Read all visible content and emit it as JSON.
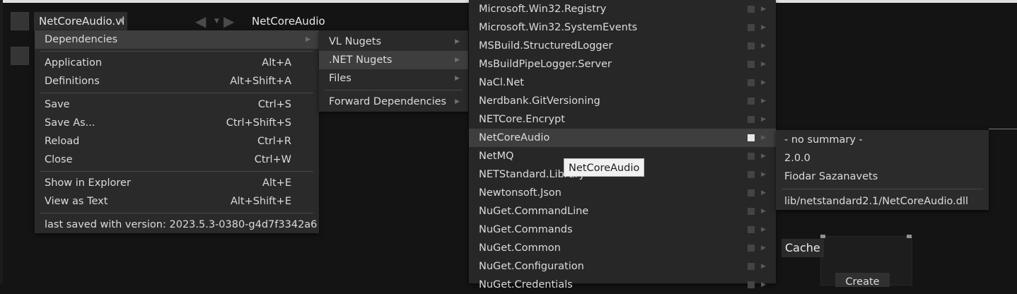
{
  "document": {
    "tab_label": "NetCoreAudio.vl",
    "title": "NetCoreAudio"
  },
  "main_menu": {
    "items": [
      {
        "label": "Dependencies",
        "shortcut": "",
        "submenu": true,
        "highlighted": true
      },
      {
        "label": "Application",
        "shortcut": "Alt+A"
      },
      {
        "label": "Definitions",
        "shortcut": "Alt+Shift+A"
      },
      {
        "label": "Save",
        "shortcut": "Ctrl+S"
      },
      {
        "label": "Save As...",
        "shortcut": "Ctrl+Shift+S"
      },
      {
        "label": "Reload",
        "shortcut": "Ctrl+R"
      },
      {
        "label": "Close",
        "shortcut": "Ctrl+W"
      },
      {
        "label": "Show in Explorer",
        "shortcut": "Alt+E"
      },
      {
        "label": "View as Text",
        "shortcut": "Alt+Shift+E"
      }
    ],
    "footer": "last saved with version: 2023.5.3-0380-g4d7f3342a6"
  },
  "dependencies_menu": {
    "items": [
      {
        "label": "VL Nugets"
      },
      {
        "label": ".NET Nugets",
        "highlighted": true
      },
      {
        "label": "Files"
      },
      {
        "label": "Forward Dependencies"
      }
    ]
  },
  "nuget_menu": {
    "items": [
      {
        "label": "Microsoft.Win32.Registry"
      },
      {
        "label": "Microsoft.Win32.SystemEvents"
      },
      {
        "label": "MSBuild.StructuredLogger"
      },
      {
        "label": "MsBuildPipeLogger.Server"
      },
      {
        "label": "NaCl.Net"
      },
      {
        "label": "Nerdbank.GitVersioning"
      },
      {
        "label": "NETCore.Encrypt"
      },
      {
        "label": "NetCoreAudio",
        "highlighted": true
      },
      {
        "label": "NetMQ"
      },
      {
        "label": "NETStandard.Library"
      },
      {
        "label": "Newtonsoft.Json"
      },
      {
        "label": "NuGet.CommandLine"
      },
      {
        "label": "NuGet.Commands"
      },
      {
        "label": "NuGet.Common"
      },
      {
        "label": "NuGet.Configuration"
      },
      {
        "label": "NuGet.Credentials"
      }
    ]
  },
  "package_info": {
    "summary": "- no summary -",
    "version": "2.0.0",
    "author": "Fiodar Sazanavets",
    "dll": "lib/netstandard2.1/NetCoreAudio.dll"
  },
  "tooltip": "NetCoreAudio",
  "patch": {
    "node_label": "Cache",
    "button_label": "Create"
  }
}
